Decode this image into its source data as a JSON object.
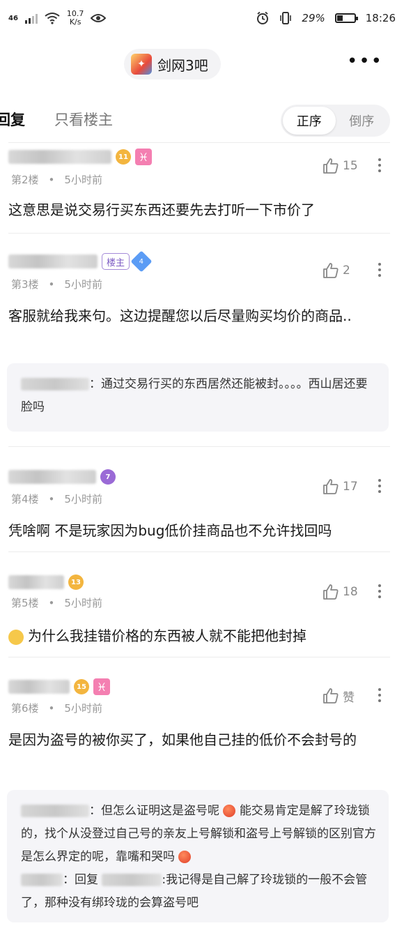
{
  "status_bar": {
    "net_type": "46",
    "speed_value": "10.7",
    "speed_unit": "K/s",
    "battery": "29%",
    "battery_level": 0.29,
    "time": "18:26"
  },
  "header": {
    "forum_name": "剑网3吧"
  },
  "tabs": {
    "reply_label": "回复",
    "only_host_label": "只看楼主",
    "sort_asc": "正序",
    "sort_desc": "倒序"
  },
  "posts": [
    {
      "floor": "第2楼",
      "time": "5小时前",
      "likes": "15",
      "level": "11",
      "content": "这意思是说交易行买东西还要先去打听一下市价了"
    },
    {
      "floor": "第3楼",
      "time": "5小时前",
      "likes": "2",
      "host_badge": "楼主",
      "level": "4",
      "content": "客服就给我来句。这边提醒您以后尽量购买均价的商品..",
      "quote": {
        "text": "通过交易行买的东西居然还能被封。。。。西山居还要脸吗"
      }
    },
    {
      "floor": "第4楼",
      "time": "5小时前",
      "likes": "17",
      "level": "7",
      "content": "凭啥啊 不是玩家因为bug低价挂商品也不允许找回吗"
    },
    {
      "floor": "第5楼",
      "time": "5小时前",
      "likes": "18",
      "level": "13",
      "content": "为什么我挂错价格的东西被人就不能把他封掉"
    },
    {
      "floor": "第6楼",
      "time": "5小时前",
      "likes": "赞",
      "level": "15",
      "content": "是因为盗号的被你买了，如果他自己挂的低价不会封号的",
      "quote": {
        "line1": "但怎么证明这是盗号呢",
        "line2": "能交易肯定是解了玲珑锁的，找个从没登过自己号的亲友上号解锁和盗号上号解锁的区别官方是怎么界定的呢，靠嘴和哭吗",
        "reply_prefix": "回复",
        "reply_text": ":我记得是自己解了玲珑锁的一般不会管了，那种没有绑玲珑的会算盗号吧"
      }
    }
  ],
  "icons": {
    "signal": "signal-icon",
    "wifi": "wifi-icon",
    "eye": "eye-icon",
    "alarm": "alarm-icon",
    "vibrate": "vibrate-icon",
    "battery": "battery-icon",
    "like": "thumbs-up-icon",
    "more": "more-dots-icon"
  },
  "colors": {
    "accent_purple": "#7d5cc4",
    "level_gold": "#f3b53f",
    "zodiac_pink": "#f47fb1"
  }
}
